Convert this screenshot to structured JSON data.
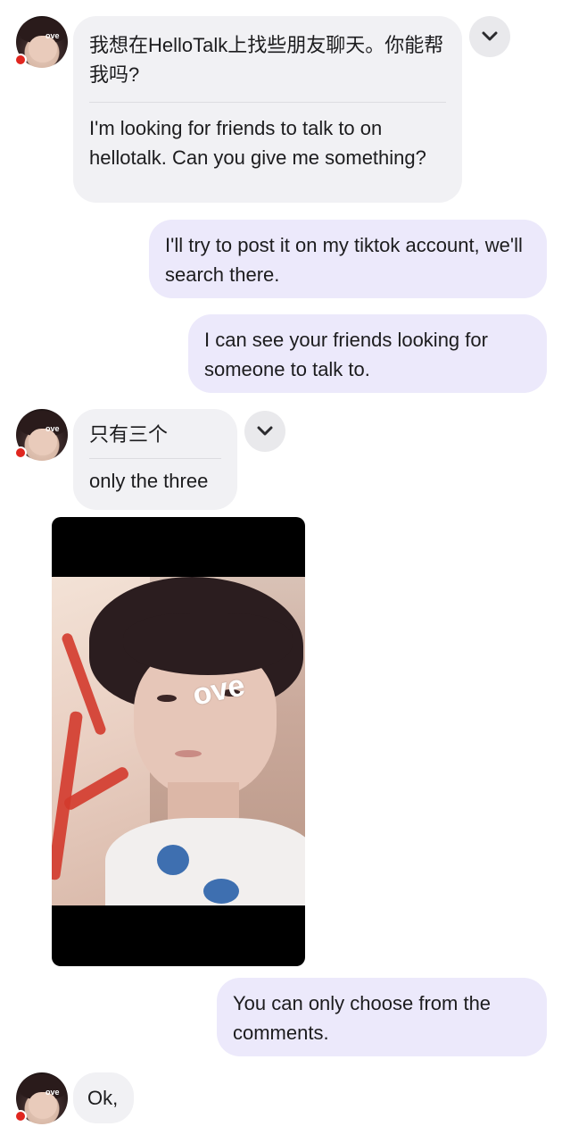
{
  "messages": [
    {
      "id": "m1",
      "direction": "incoming",
      "original": "我想在HelloTalk上找些朋友聊天。你能帮我吗?",
      "translation": "I'm looking for friends to talk to on hellotalk. Can you give me something?"
    },
    {
      "id": "m2",
      "direction": "outgoing",
      "text": "I'll try to post it on my tiktok account, we'll search there."
    },
    {
      "id": "m3",
      "direction": "outgoing",
      "text": "I can see your friends looking for someone to talk to."
    },
    {
      "id": "m4",
      "direction": "incoming",
      "original": "只有三个",
      "translation": "only the three"
    },
    {
      "id": "m5",
      "direction": "incoming",
      "type": "image",
      "overlay_text": "ove"
    },
    {
      "id": "m6",
      "direction": "outgoing",
      "text": "You can only choose from the comments."
    },
    {
      "id": "m7",
      "direction": "incoming",
      "text": "Ok,"
    }
  ],
  "avatar": {
    "overlay_text": "ove"
  },
  "icons": {
    "translate_toggle": "chevron-down-icon",
    "online_status": "status-dot"
  },
  "colors": {
    "incoming_bubble": "#f1f1f4",
    "outgoing_bubble": "#ece9fb",
    "status_dot": "#e0261f"
  }
}
